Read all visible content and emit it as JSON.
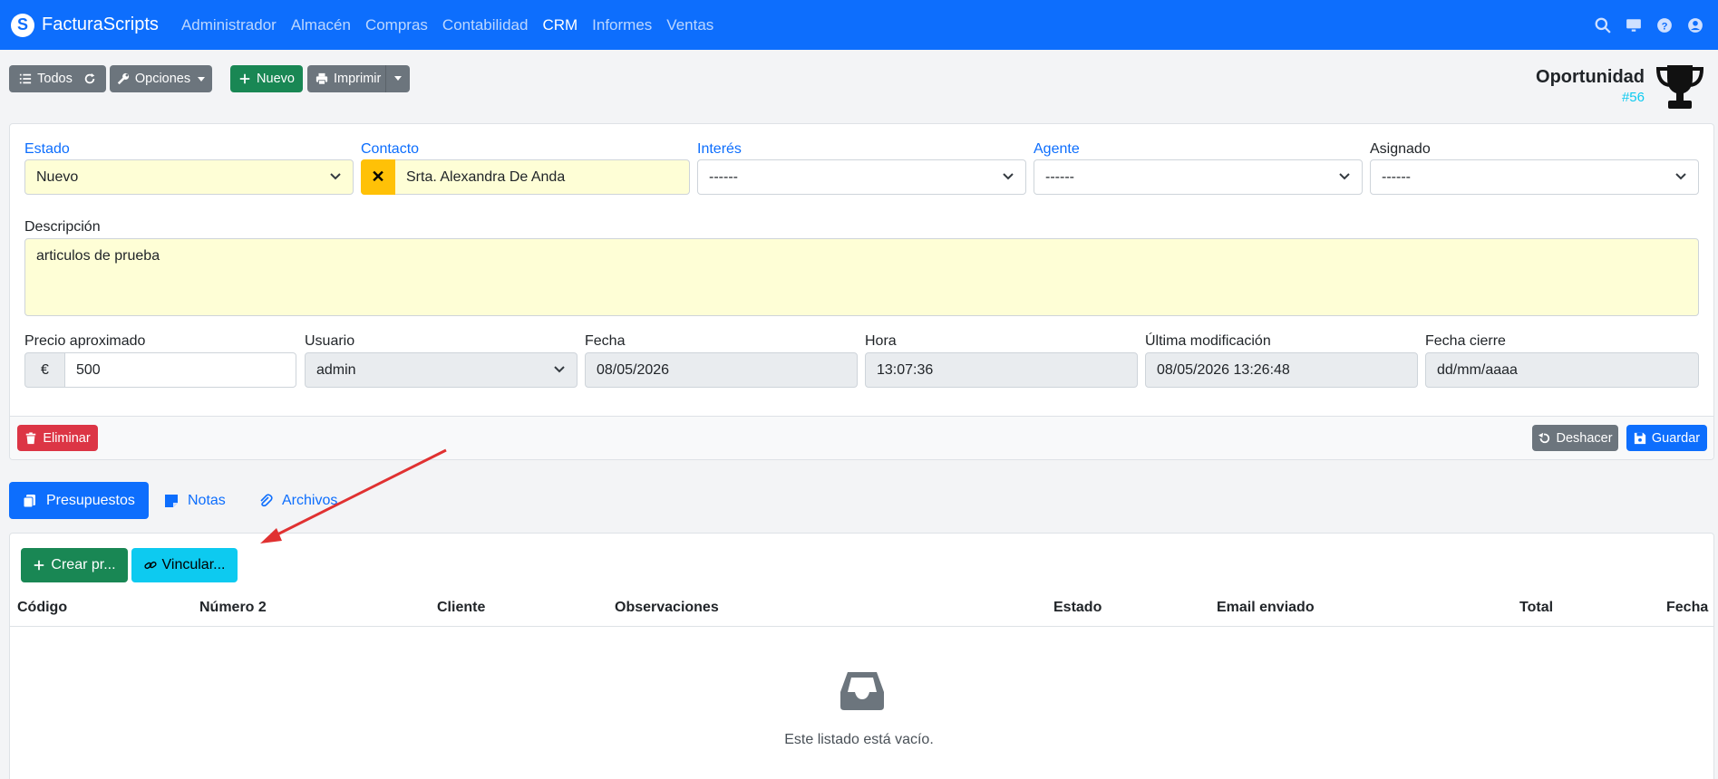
{
  "navbar": {
    "brand": "FacturaScripts",
    "menu": [
      "Administrador",
      "Almacén",
      "Compras",
      "Contabilidad",
      "CRM",
      "Informes",
      "Ventas"
    ],
    "active": "CRM",
    "icons": [
      "search-icon",
      "monitor-icon",
      "help-icon",
      "user-icon"
    ]
  },
  "toolbar": {
    "all_label": "Todos",
    "options_label": "Opciones",
    "new_label": "Nuevo",
    "print_label": "Imprimir"
  },
  "header": {
    "title": "Oportunidad",
    "code": "#56",
    "icon": "trophy-icon"
  },
  "form": {
    "estado": {
      "label": "Estado",
      "value": "Nuevo"
    },
    "contacto": {
      "label": "Contacto",
      "value": "Srta. Alexandra De Anda",
      "clear": "✕"
    },
    "interes": {
      "label": "Interés",
      "value": "------"
    },
    "agente": {
      "label": "Agente",
      "value": "------"
    },
    "asignado": {
      "label": "Asignado",
      "value": "------"
    },
    "descripcion": {
      "label": "Descripción",
      "value": "articulos de prueba"
    },
    "precio": {
      "label": "Precio aproximado",
      "currency": "€",
      "value": "500"
    },
    "usuario": {
      "label": "Usuario",
      "value": "admin"
    },
    "fecha": {
      "label": "Fecha",
      "value": "08/05/2026"
    },
    "hora": {
      "label": "Hora",
      "value": "13:07:36"
    },
    "ultima": {
      "label": "Última modificación",
      "value": "08/05/2026 13:26:48"
    },
    "cierre": {
      "label": "Fecha cierre",
      "value": "dd/mm/aaaa"
    }
  },
  "actions": {
    "delete_label": "Eliminar",
    "undo_label": "Deshacer",
    "save_label": "Guardar"
  },
  "tabs": [
    {
      "label": "Presupuestos",
      "active": true
    },
    {
      "label": "Notas",
      "active": false
    },
    {
      "label": "Archivos",
      "active": false
    }
  ],
  "list": {
    "create_label": "Crear pr...",
    "link_label": "Vincular...",
    "columns": [
      "Código",
      "Número 2",
      "Cliente",
      "Observaciones",
      "Estado",
      "Email enviado",
      "Total",
      "Fecha"
    ],
    "empty_text": "Este listado está vacío."
  },
  "colors": {
    "primary": "#0d6efd",
    "success": "#198754",
    "danger": "#dc3545",
    "info": "#0dcaf0",
    "warning": "#ffc107",
    "secondary": "#6c757d"
  }
}
